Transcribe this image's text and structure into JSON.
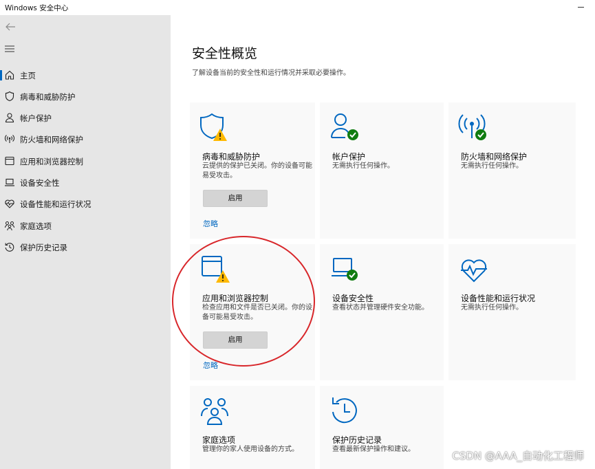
{
  "window": {
    "title": "Windows 安全中心"
  },
  "sidebar": {
    "items": [
      {
        "label": "主页",
        "icon": "home-icon"
      },
      {
        "label": "病毒和威胁防护",
        "icon": "shield-icon"
      },
      {
        "label": "帐户保护",
        "icon": "person-icon"
      },
      {
        "label": "防火墙和网络保护",
        "icon": "wifi-signal-icon"
      },
      {
        "label": "应用和浏览器控制",
        "icon": "browser-window-icon"
      },
      {
        "label": "设备安全性",
        "icon": "laptop-icon"
      },
      {
        "label": "设备性能和运行状况",
        "icon": "heart-pulse-icon"
      },
      {
        "label": "家庭选项",
        "icon": "family-icon"
      },
      {
        "label": "保护历史记录",
        "icon": "history-icon"
      }
    ],
    "active_index": 0
  },
  "main": {
    "title": "安全性概览",
    "subtitle": "了解设备当前的安全性和运行情况并采取必要操作。",
    "cards": [
      {
        "title": "病毒和威胁防护",
        "desc": "云提供的保护已关闭。你的设备可能易受攻击。",
        "button": "启用",
        "link": "忽略",
        "status": "warning",
        "icon": "shield-icon"
      },
      {
        "title": "帐户保护",
        "desc": "无需执行任何操作。",
        "status": "ok",
        "icon": "person-icon"
      },
      {
        "title": "防火墙和网络保护",
        "desc": "无需执行任何操作。",
        "status": "ok",
        "icon": "wifi-signal-icon"
      },
      {
        "title": "应用和浏览器控制",
        "desc": "检查应用和文件是否已关闭。你的设备可能易受攻击。",
        "button": "启用",
        "link": "忽略",
        "status": "warning",
        "icon": "browser-window-icon"
      },
      {
        "title": "设备安全性",
        "desc": "查看状态并管理硬件安全功能。",
        "status": "ok",
        "icon": "laptop-icon"
      },
      {
        "title": "设备性能和运行状况",
        "desc": "无需执行任何操作。",
        "status": "none",
        "icon": "heart-pulse-icon"
      },
      {
        "title": "家庭选项",
        "desc": "管理你的家人使用设备的方式。",
        "status": "none",
        "icon": "family-icon"
      },
      {
        "title": "保护历史记录",
        "desc": "查看最新保护操作和建议。",
        "status": "none",
        "icon": "history-icon"
      }
    ]
  },
  "watermark": "CSDN @AAA_自动化工程师",
  "colors": {
    "accent": "#0067c0",
    "ok": "#107c10",
    "warning": "#ffb900",
    "annotation": "#d8262a",
    "sidebar_bg": "#e6e6e6",
    "card_bg": "#f9f9f9"
  }
}
